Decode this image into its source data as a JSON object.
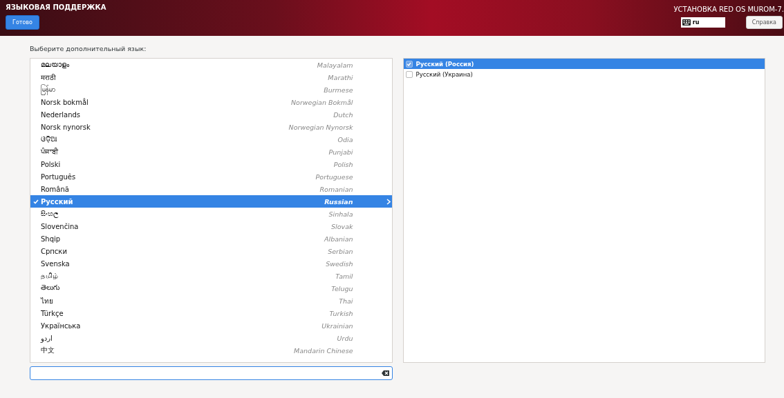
{
  "header": {
    "title": "ЯЗЫКОВАЯ ПОДДЕРЖКА",
    "done_button": "Готово",
    "product_title": "УСТАНОВКА RED OS MUROM-7.",
    "keyboard_layout": "ru",
    "help_button": "Справка"
  },
  "prompt": "Выберите дополнительный язык:",
  "languages": [
    {
      "native": "മലയാളം",
      "english": "Malayalam",
      "selected": false
    },
    {
      "native": "मराठी",
      "english": "Marathi",
      "selected": false
    },
    {
      "native": "မြန်မာ",
      "english": "Burmese",
      "selected": false
    },
    {
      "native": "Norsk bokmål",
      "english": "Norwegian Bokmål",
      "selected": false
    },
    {
      "native": "Nederlands",
      "english": "Dutch",
      "selected": false
    },
    {
      "native": "Norsk nynorsk",
      "english": "Norwegian Nynorsk",
      "selected": false
    },
    {
      "native": "ଓଡ଼ିଆ",
      "english": "Odia",
      "selected": false
    },
    {
      "native": "ਪੰਜਾਬੀ",
      "english": "Punjabi",
      "selected": false
    },
    {
      "native": "Polski",
      "english": "Polish",
      "selected": false
    },
    {
      "native": "Português",
      "english": "Portuguese",
      "selected": false
    },
    {
      "native": "Română",
      "english": "Romanian",
      "selected": false
    },
    {
      "native": "Русский",
      "english": "Russian",
      "selected": true
    },
    {
      "native": "සිංහල",
      "english": "Sinhala",
      "selected": false
    },
    {
      "native": "Slovenčina",
      "english": "Slovak",
      "selected": false
    },
    {
      "native": "Shqip",
      "english": "Albanian",
      "selected": false
    },
    {
      "native": "Српски",
      "english": "Serbian",
      "selected": false
    },
    {
      "native": "Svenska",
      "english": "Swedish",
      "selected": false
    },
    {
      "native": "தமிழ்",
      "english": "Tamil",
      "selected": false
    },
    {
      "native": "తెలుగు",
      "english": "Telugu",
      "selected": false
    },
    {
      "native": "ไทย",
      "english": "Thai",
      "selected": false
    },
    {
      "native": "Türkçe",
      "english": "Turkish",
      "selected": false
    },
    {
      "native": "Українська",
      "english": "Ukrainian",
      "selected": false
    },
    {
      "native": "اردو",
      "english": "Urdu",
      "selected": false
    },
    {
      "native": "中文",
      "english": "Mandarin Chinese",
      "selected": false
    }
  ],
  "locales": [
    {
      "label": "Русский (Россия)",
      "checked": true,
      "selected": true
    },
    {
      "label": "Русский (Украина)",
      "checked": false,
      "selected": false
    }
  ]
}
